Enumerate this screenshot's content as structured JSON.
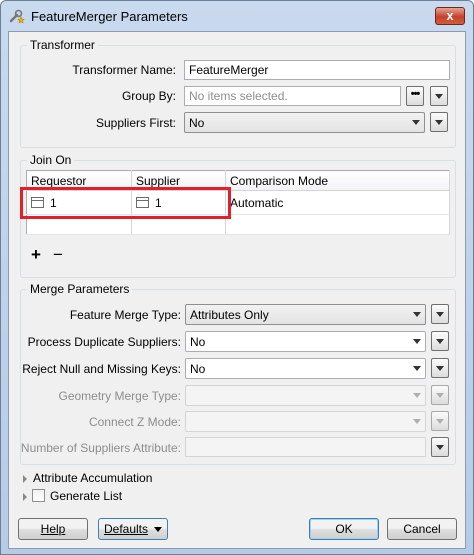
{
  "window": {
    "title": "FeatureMerger Parameters",
    "close_glyph": "x",
    "icon": "wrench-star-icon"
  },
  "transformer": {
    "group_label": "Transformer",
    "name_label": "Transformer Name:",
    "name_value": "FeatureMerger",
    "group_by_label": "Group By:",
    "group_by_placeholder": "No items selected.",
    "group_by_button": "•••",
    "suppliers_first_label": "Suppliers First:",
    "suppliers_first_value": "No"
  },
  "join_on": {
    "group_label": "Join On",
    "columns": [
      "Requestor",
      "Supplier",
      "Comparison Mode"
    ],
    "rows": [
      {
        "requestor": "1",
        "supplier": "1",
        "mode": "Automatic"
      }
    ],
    "add_glyph": "+",
    "remove_glyph": "−",
    "highlight_color": "#e0202a"
  },
  "merge": {
    "group_label": "Merge Parameters",
    "feature_merge_type_label": "Feature Merge Type:",
    "feature_merge_type_value": "Attributes Only",
    "process_duplicate_label": "Process Duplicate Suppliers:",
    "process_duplicate_value": "No",
    "reject_null_label": "Reject Null and Missing Keys:",
    "reject_null_value": "No",
    "geometry_merge_label": "Geometry Merge Type:",
    "geometry_merge_value": "",
    "connect_z_label": "Connect Z Mode:",
    "connect_z_value": "",
    "num_suppliers_label": "Number of Suppliers Attribute:",
    "num_suppliers_value": ""
  },
  "sections": {
    "attribute_accumulation": "Attribute Accumulation",
    "generate_list": "Generate List"
  },
  "buttons": {
    "help": "Help",
    "defaults": "Defaults",
    "ok": "OK",
    "cancel": "Cancel"
  }
}
